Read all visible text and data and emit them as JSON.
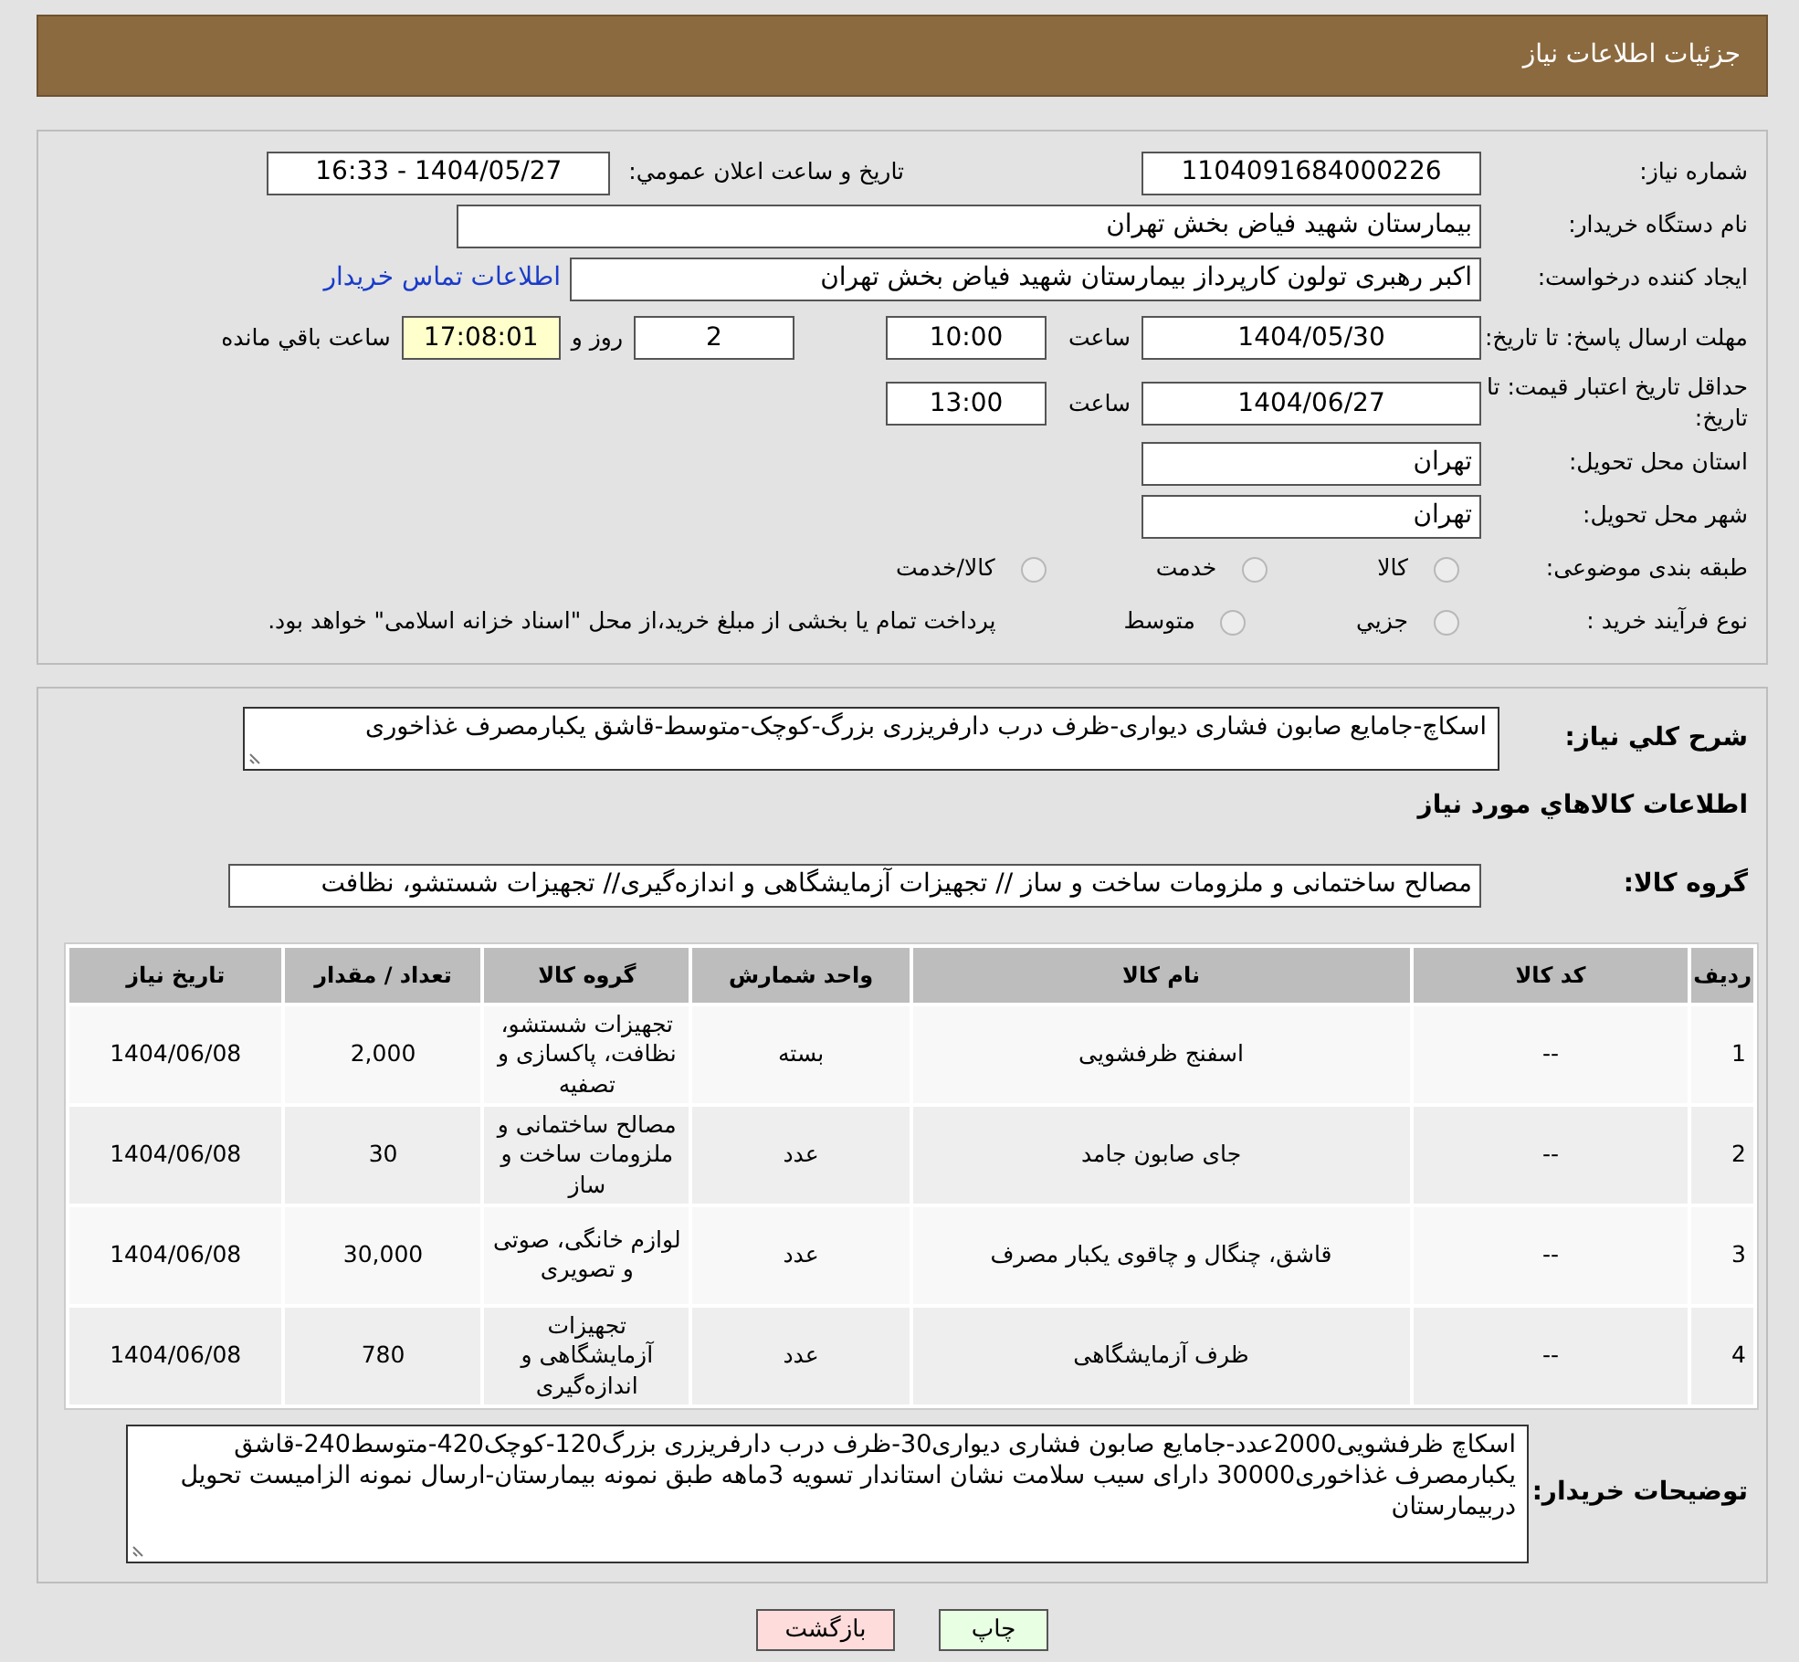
{
  "header": {
    "title": "جزئیات اطلاعات نیاز"
  },
  "form": {
    "need_number": {
      "label": "شماره نیاز:",
      "value": "1104091684000226"
    },
    "announce": {
      "label": "تاریخ و ساعت اعلان عمومي:",
      "value": "1404/05/27 - 16:33"
    },
    "buyer": {
      "label": "نام دستگاه خریدار:",
      "value": "بیمارستان شهید فیاض بخش تهران"
    },
    "creator": {
      "label": "ایجاد کننده درخواست:",
      "value": "اکبر رهبری تولون کارپرداز بیمارستان شهید فیاض بخش تهران",
      "link": "اطلاعات تماس خریدار"
    },
    "deadline": {
      "label": "مهلت ارسال پاسخ: تا تاریخ:",
      "date": "1404/05/30",
      "time_label": "ساعت",
      "time": "10:00",
      "days": "2",
      "days_label": "روز و",
      "remaining": "17:08:01",
      "remaining_label": "ساعت باقي مانده"
    },
    "validity": {
      "label": "حداقل تاریخ اعتبار قیمت: تا تاریخ:",
      "date": "1404/06/27",
      "time_label": "ساعت",
      "time": "13:00"
    },
    "province": {
      "label": "استان محل تحویل:",
      "value": "تهران"
    },
    "city": {
      "label": "شهر محل تحویل:",
      "value": "تهران"
    },
    "category": {
      "label": "طبقه بندی موضوعی:",
      "options": [
        {
          "label": "کالا",
          "selected": false
        },
        {
          "label": "خدمت",
          "selected": false
        },
        {
          "label": "کالا/خدمت",
          "selected": false
        }
      ]
    },
    "process": {
      "label": "نوع فرآیند خرید :",
      "options": [
        {
          "label": "جزيي",
          "selected": false
        },
        {
          "label": "متوسط",
          "selected": false
        }
      ],
      "note": "پرداخت تمام یا بخشی از مبلغ خرید،از محل \"اسناد خزانه اسلامی\" خواهد بود."
    }
  },
  "description": {
    "label": "شرح کلي نیاز:",
    "value": "اسکاچ-جامایع صابون فشاری دیواری-ظرف درب دارفریزری بزرگ-کوچک-متوسط-قاشق یکبارمصرف غذاخوری"
  },
  "items_title": "اطلاعات کالاهاي مورد نیاز",
  "goods_group": {
    "label": "گروه کالا:",
    "value": "مصالح ساختمانی و ملزومات ساخت و ساز // تجهیزات آزمایشگاهی و اندازه‌گیری// تجهیزات شستشو، نظافت"
  },
  "table": {
    "columns": [
      "ردیف",
      "کد کالا",
      "نام کالا",
      "واحد شمارش",
      "گروه کالا",
      "تعداد / مقدار",
      "تاریخ نیاز"
    ],
    "rows": [
      [
        "1",
        "--",
        "اسفنج ظرفشویی",
        "بسته",
        "تجهیزات شستشو، نظافت، پاکسازی و تصفیه",
        "2,000",
        "1404/06/08"
      ],
      [
        "2",
        "--",
        "جای صابون جامد",
        "عدد",
        "مصالح ساختمانی و ملزومات ساخت و ساز",
        "30",
        "1404/06/08"
      ],
      [
        "3",
        "--",
        "قاشق، چنگال و چاقوی یکبار مصرف",
        "عدد",
        "لوازم خانگی، صوتی و تصویری",
        "30,000",
        "1404/06/08"
      ],
      [
        "4",
        "--",
        "ظرف آزمایشگاهی",
        "عدد",
        "تجهیزات آزمایشگاهی و اندازه‌گیری",
        "780",
        "1404/06/08"
      ]
    ]
  },
  "buyer_notes": {
    "label": "توضیحات خریدار:",
    "value": "اسکاچ ظرفشویی2000عدد-جامایع صابون فشاری دیواری30-ظرف درب دارفریزری بزرگ120-کوچک420-متوسط240-قاشق یکبارمصرف غذاخوری30000 دارای سیب سلامت نشان استاندار تسویه 3ماهه طبق نمونه بیمارستان-ارسال نمونه الزامیست تحویل دربیمارستان"
  },
  "buttons": [
    {
      "label": "چاپ",
      "kind": "print"
    },
    {
      "label": "بازگشت",
      "kind": "back"
    }
  ]
}
